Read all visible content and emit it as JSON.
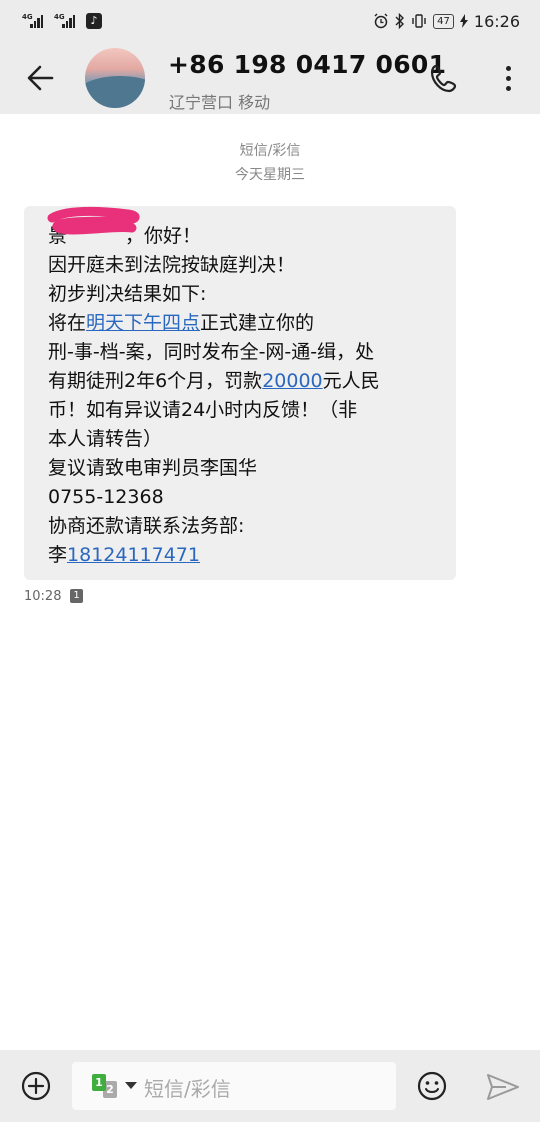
{
  "status_bar": {
    "signal1": "4G",
    "signal2": "4G",
    "battery": "47",
    "time": "16:26",
    "icons": [
      "tiktok-icon",
      "alarm-icon",
      "bluetooth-icon",
      "vibrate-icon",
      "battery-icon",
      "charging-icon"
    ]
  },
  "header": {
    "title": "+86 198 0417 0601",
    "subtitle": "辽宁营口 移动",
    "icons": [
      "back-arrow-icon",
      "phone-icon",
      "more-vertical-icon"
    ]
  },
  "conversation": {
    "type_label": "短信/彩信",
    "date_label": "今天星期三"
  },
  "message": {
    "lines": {
      "l1_prefix": "景",
      "l1_rest": "，你好！",
      "l2": "因开庭未到法院按缺庭判决！",
      "l3": "初步判决结果如下:",
      "l4_pre": "将在",
      "l4_link": "明天下午四点",
      "l4_post": "正式建立你的",
      "l5": "刑-事-档-案，同时发布全-网-通-缉，处",
      "l6_pre": "有期徒刑2年6个月，罚款",
      "l6_link": "20000",
      "l6_post": "元人民",
      "l7": "币！如有异议请24小时内反馈！（非",
      "l8": "本人请转告）",
      "l9": "复议请致电审判员李国华",
      "l10": "0755-12368",
      "l11": "协商还款请联系法务部:",
      "l12_pre": "李",
      "l12_link": "18124117471"
    },
    "time": "10:28",
    "sim": "1",
    "redaction_color": "#e8317a"
  },
  "composer": {
    "placeholder": "短信/彩信",
    "sim_primary": "1",
    "sim_secondary": "2",
    "sim_primary_color": "#3fae3f"
  }
}
